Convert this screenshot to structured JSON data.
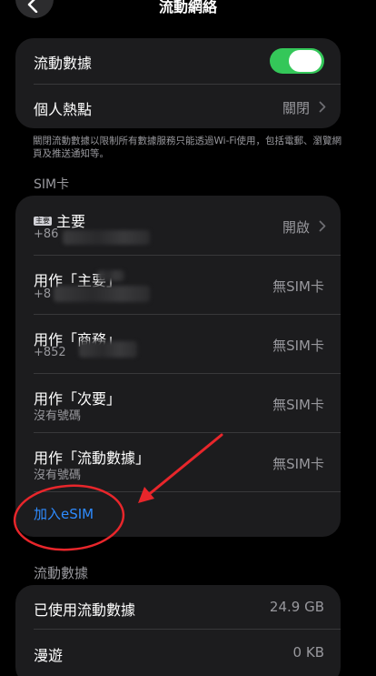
{
  "nav": {
    "title": "流動網絡"
  },
  "top_group": {
    "cellular_data": {
      "label": "流動數據",
      "enabled": true
    },
    "hotspot": {
      "label": "個人熱點",
      "value": "關閉"
    }
  },
  "footnote": "關閉流動數據以限制所有數據服務只能透過Wi‑Fi使用，包括電郵、瀏覽網頁及推送通知等。",
  "sim_section": {
    "title": "SIM卡",
    "rows": [
      {
        "label": "主要",
        "badge": "主要",
        "sub": "+86",
        "value": "開啟"
      },
      {
        "label": "用作「主要」",
        "sub": "+8",
        "value": "無SIM卡"
      },
      {
        "label": "用作「商務」",
        "sub": "+852",
        "value": "無SIM卡"
      },
      {
        "label": "用作「次要」",
        "sub": "沒有號碼",
        "value": "無SIM卡"
      },
      {
        "label": "用作「流動數據」",
        "sub": "沒有號碼",
        "value": "無SIM卡"
      }
    ],
    "add_esim": "加入eSIM"
  },
  "data_section": {
    "title": "流動數據",
    "rows": [
      {
        "label": "已使用流動數據",
        "value": "24.9 GB"
      },
      {
        "label": "漫遊",
        "value": "0 KB"
      }
    ]
  },
  "colors": {
    "accent": "#2e8bff",
    "toggle_on": "#34c759",
    "annotation": "#e8262b"
  }
}
